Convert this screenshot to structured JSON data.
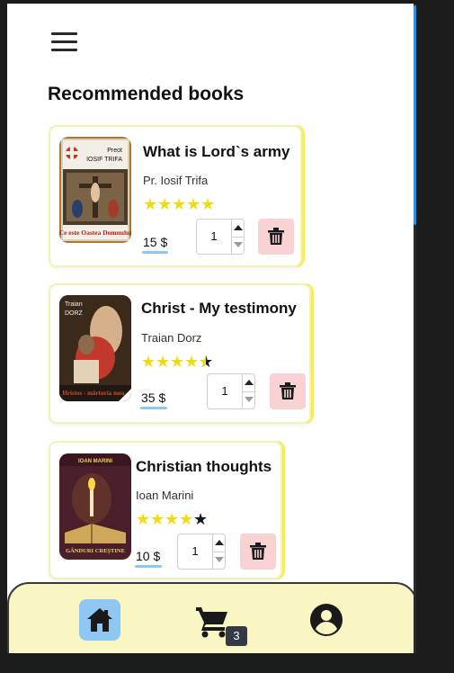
{
  "header": {
    "menu_icon": "hamburger-icon"
  },
  "section_title": "Recommended books",
  "books": [
    {
      "title": "What is Lord`s army",
      "author": "Pr. Iosif Trifa",
      "rating": 5,
      "price": "15 $",
      "quantity": "1",
      "cover": {
        "top_text_1": "Preot",
        "top_text_2": "IOSIF TRIFA",
        "bottom_text": "Ce este Oastea Domnului"
      }
    },
    {
      "title": "Christ - My testimony",
      "author": "Traian Dorz",
      "rating": 4.5,
      "price": "35 $",
      "quantity": "1",
      "cover": {
        "top_text_1": "Traian",
        "top_text_2": "DORZ",
        "bottom_text": "Hristos - mărturia mea"
      }
    },
    {
      "title": "Christian thoughts",
      "author": "Ioan Marini",
      "rating": 4,
      "price": "10 $",
      "quantity": "1",
      "cover": {
        "top_text_1": "IOAN MARINI",
        "bottom_text": "GÂNDURI CREȘTINE"
      }
    }
  ],
  "bottom_nav": {
    "items": [
      {
        "name": "home",
        "icon": "home-icon",
        "active": true
      },
      {
        "name": "cart",
        "icon": "cart-icon",
        "badge": "3"
      },
      {
        "name": "account",
        "icon": "account-circle-icon"
      }
    ]
  },
  "colors": {
    "star": "#f2dc11",
    "star_empty": "#14142a",
    "price_underline": "#8ec8f2",
    "delete_bg": "#f9d3d3",
    "nav_bg": "#f9f6c3",
    "active_nav": "#8ec8f2",
    "card_accent": "#f5ec65"
  }
}
